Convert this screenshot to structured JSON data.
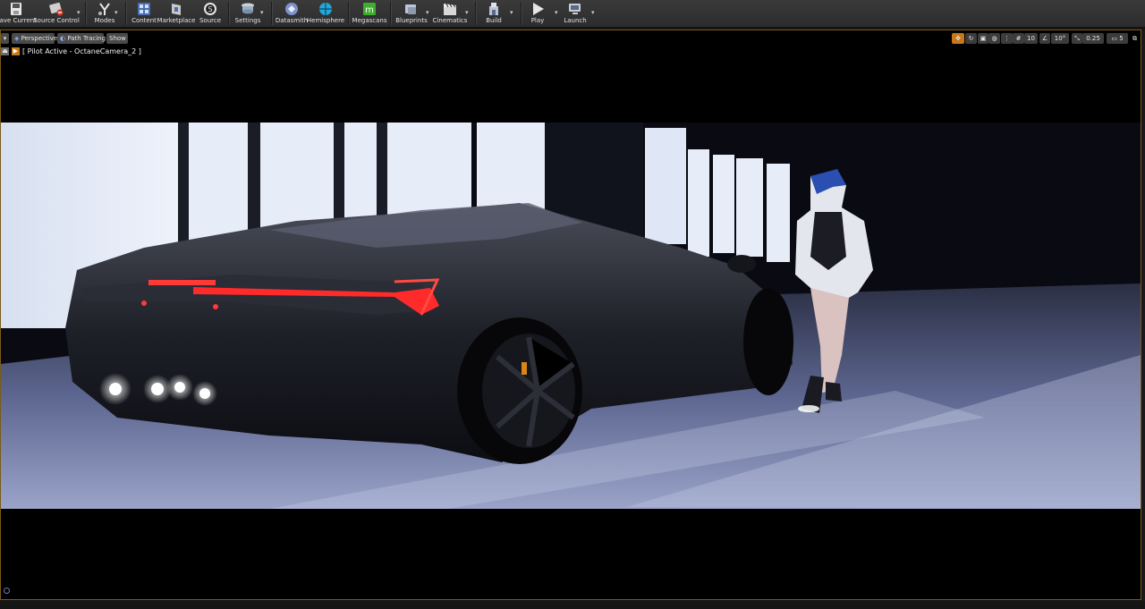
{
  "toolbar": {
    "buttons": [
      {
        "label": "Save Current",
        "icon": "save-icon"
      },
      {
        "label": "Source Control",
        "icon": "source-control-icon"
      },
      {
        "label": "Modes",
        "icon": "modes-icon"
      },
      {
        "label": "Content",
        "icon": "content-icon"
      },
      {
        "label": "Marketplace",
        "icon": "marketplace-icon"
      },
      {
        "label": "Source",
        "icon": "source-icon"
      },
      {
        "label": "Settings",
        "icon": "settings-icon"
      },
      {
        "label": "Datasmith",
        "icon": "datasmith-icon"
      },
      {
        "label": "Hemisphere",
        "icon": "hemisphere-icon"
      },
      {
        "label": "Megascans",
        "icon": "megascans-icon"
      },
      {
        "label": "Blueprints",
        "icon": "blueprints-icon"
      },
      {
        "label": "Cinematics",
        "icon": "cinematics-icon"
      },
      {
        "label": "Build",
        "icon": "build-icon"
      },
      {
        "label": "Play",
        "icon": "play-icon"
      },
      {
        "label": "Launch",
        "icon": "launch-icon"
      }
    ]
  },
  "viewport": {
    "perspective_label": "Perspective",
    "path_tracing_label": "Path Tracing",
    "show_label": "Show",
    "pilot_text": "[ Pilot Active - OctaneCamera_2 ]",
    "grid_snap": "10",
    "rotation_snap": "10°",
    "scale_snap": "0.25",
    "camera_speed": "5",
    "border_color": "#7a5a18",
    "megascans_color": "#3fae2a"
  }
}
